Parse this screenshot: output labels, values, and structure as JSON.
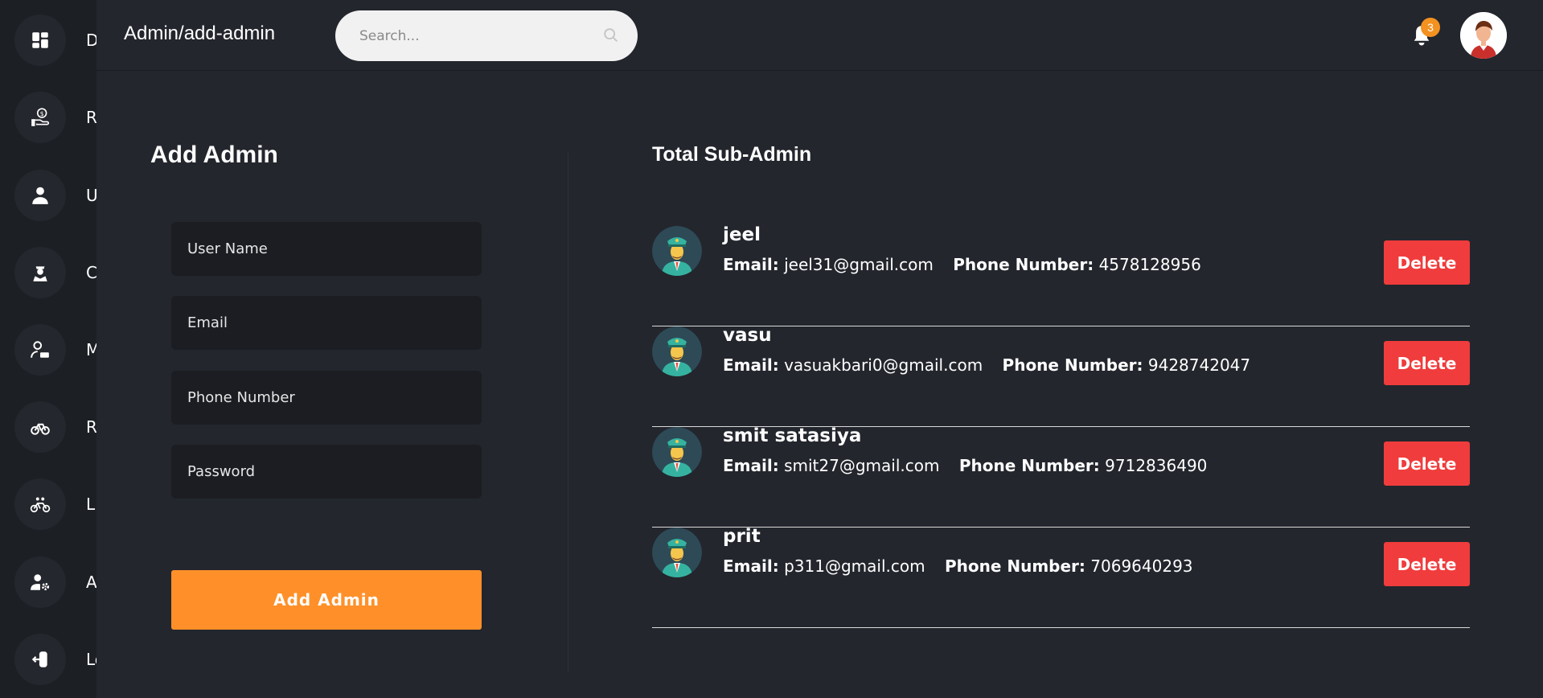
{
  "sidebar": {
    "items": [
      {
        "label": "D",
        "icon": "dashboard-icon"
      },
      {
        "label": "Re",
        "icon": "money-hand-icon"
      },
      {
        "label": "Us",
        "icon": "user-icon"
      },
      {
        "label": "C",
        "icon": "captain-icon"
      },
      {
        "label": "M",
        "icon": "user-card-icon"
      },
      {
        "label": "Ri",
        "icon": "bicycle-icon"
      },
      {
        "label": "Li",
        "icon": "tandem-bike-icon"
      },
      {
        "label": "Ad",
        "icon": "user-gear-icon"
      },
      {
        "label": "Lo",
        "icon": "logout-icon"
      }
    ]
  },
  "header": {
    "breadcrumb": "Admin/add-admin",
    "search_placeholder": "Search...",
    "notification_count": "3"
  },
  "form": {
    "title": "Add Admin",
    "username_placeholder": "User Name",
    "email_placeholder": "Email",
    "phone_placeholder": "Phone Number",
    "password_placeholder": "Password",
    "submit_label": "Add Admin"
  },
  "list": {
    "title": "Total Sub-Admin",
    "email_label": "Email:",
    "phone_label": "Phone Number:",
    "delete_label": "Delete",
    "admins": [
      {
        "name": "jeel",
        "email": "jeel31@gmail.com",
        "phone": "4578128956"
      },
      {
        "name": "vasu",
        "email": "vasuakbari0@gmail.com",
        "phone": "9428742047"
      },
      {
        "name": "smit satasiya",
        "email": "smit27@gmail.com",
        "phone": "9712836490"
      },
      {
        "name": "prit",
        "email": "p311@gmail.com",
        "phone": "7069640293"
      }
    ]
  },
  "colors": {
    "accent": "#ff9029",
    "danger": "#f03c3c",
    "background": "#23262d",
    "sidebar": "#1c1f24"
  }
}
